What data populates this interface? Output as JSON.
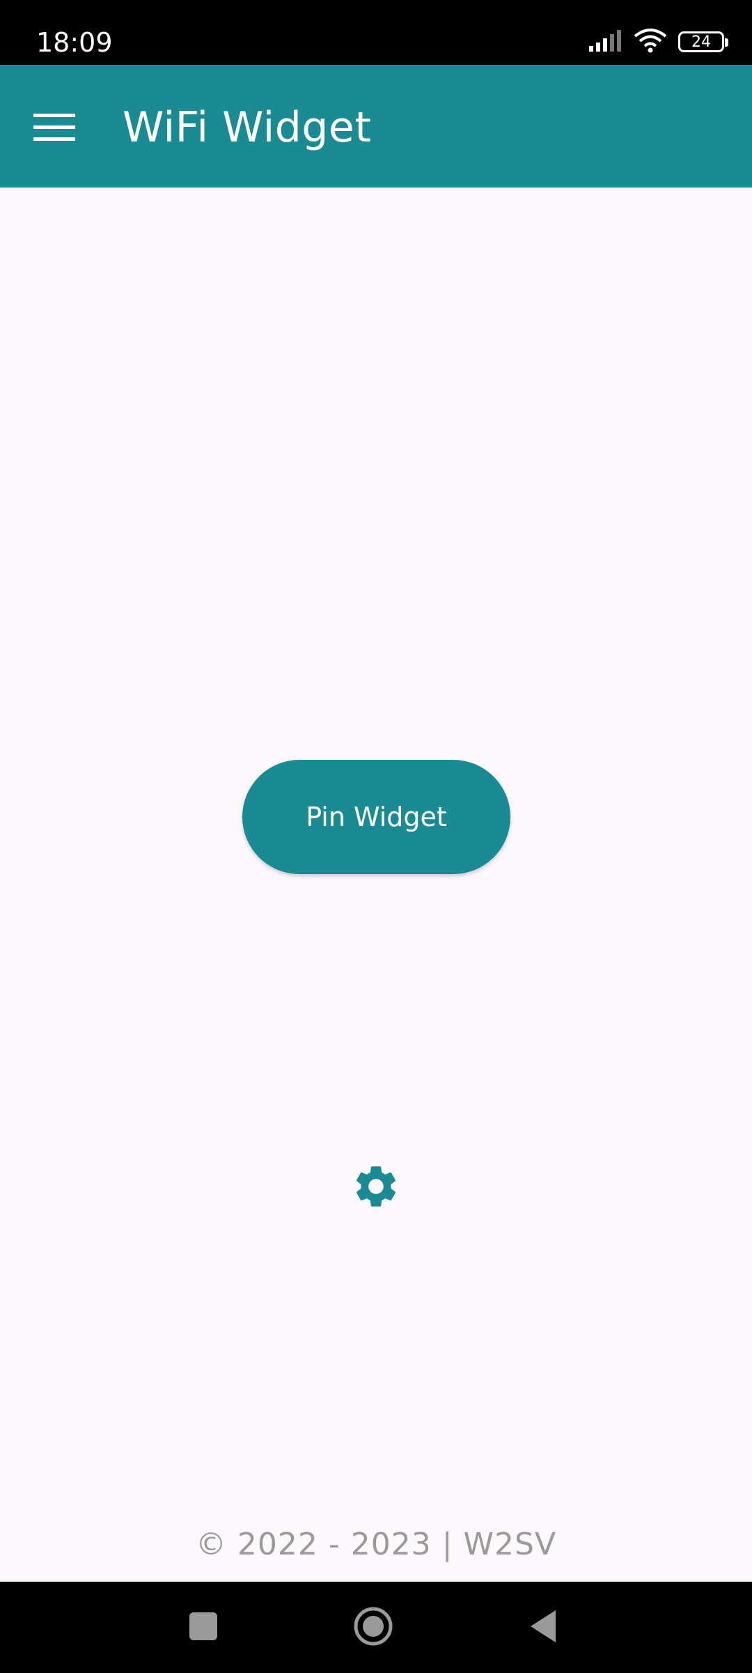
{
  "status_bar": {
    "time": "18:09",
    "battery_level": "24",
    "icons": [
      "signal-icon",
      "wifi-icon",
      "battery-icon"
    ]
  },
  "app_bar": {
    "title": "WiFi Widget",
    "menu_icon": "hamburger-menu-icon",
    "background_color": "#1a8a93"
  },
  "main": {
    "pin_button_label": "Pin Widget",
    "settings_icon": "gear-icon"
  },
  "footer": {
    "copyright": "© 2022 - 2023 | W2SV"
  },
  "nav_bar": {
    "buttons": [
      "recents-button",
      "home-button",
      "back-button"
    ]
  },
  "colors": {
    "accent": "#1a8a93",
    "background": "#fdf8fc",
    "footer_text": "#9a9a9a"
  }
}
